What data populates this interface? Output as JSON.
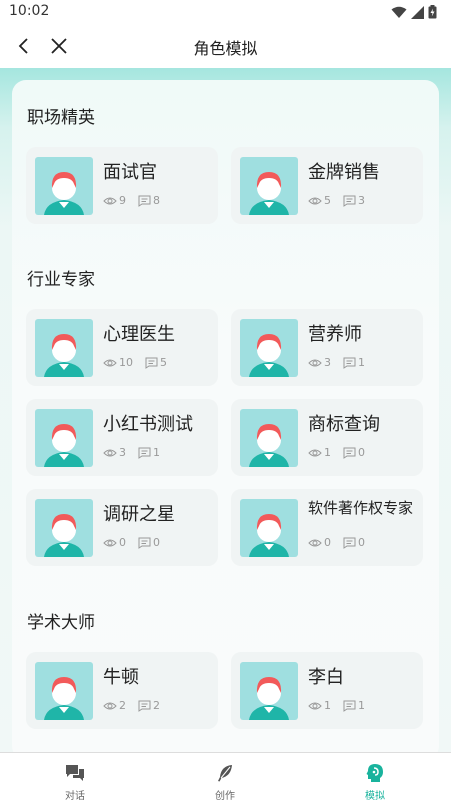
{
  "status_bar": {
    "time": "10:02"
  },
  "header": {
    "title": "角色模拟"
  },
  "sections": [
    {
      "title": "职场精英",
      "cards": [
        {
          "name": "面试官",
          "views": "9",
          "comments": "8"
        },
        {
          "name": "金牌销售",
          "views": "5",
          "comments": "3"
        }
      ]
    },
    {
      "title": "行业专家",
      "cards": [
        {
          "name": "心理医生",
          "views": "10",
          "comments": "5"
        },
        {
          "name": "营养师",
          "views": "3",
          "comments": "1"
        },
        {
          "name": "小红书测试",
          "views": "3",
          "comments": "1"
        },
        {
          "name": "商标查询",
          "views": "1",
          "comments": "0"
        },
        {
          "name": "调研之星",
          "views": "0",
          "comments": "0"
        },
        {
          "name": "软件著作权专家",
          "views": "0",
          "comments": "0"
        }
      ]
    },
    {
      "title": "学术大师",
      "cards": [
        {
          "name": "牛顿",
          "views": "2",
          "comments": "2"
        },
        {
          "name": "李白",
          "views": "1",
          "comments": "1"
        }
      ]
    }
  ],
  "bottom_nav": [
    {
      "label": "对话",
      "icon": "chat-icon"
    },
    {
      "label": "创作",
      "icon": "feather-icon"
    },
    {
      "label": "模拟",
      "icon": "head-profile-icon"
    }
  ],
  "colors": {
    "accent": "#19b39d",
    "avatar_bg": "#9fdfe0",
    "hair": "#f25a5a",
    "shirt": "#1fb5a8"
  }
}
